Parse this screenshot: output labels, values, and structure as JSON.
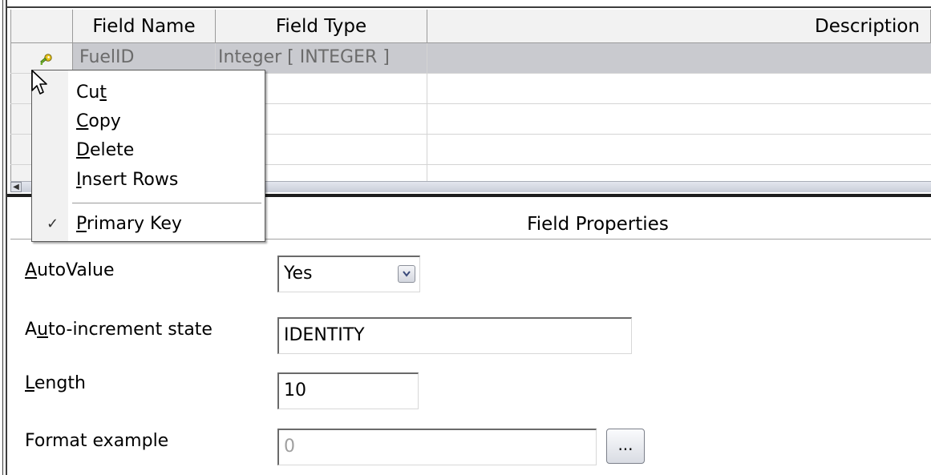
{
  "table": {
    "columns": [
      "Field Name",
      "Field Type",
      "Description"
    ],
    "rows": [
      {
        "name": "FuelID",
        "type": "Integer [ INTEGER ]",
        "description": "",
        "primary_key": true
      }
    ]
  },
  "context_menu": {
    "items": [
      {
        "label": "Cut",
        "mnemonic": "t"
      },
      {
        "label": "Copy",
        "mnemonic": "C"
      },
      {
        "label": "Delete",
        "mnemonic": "D"
      },
      {
        "label": "Insert Rows",
        "mnemonic": "I"
      }
    ],
    "checked_item": {
      "label": "Primary Key",
      "mnemonic": "P",
      "checked": true
    }
  },
  "properties": {
    "title": "Field Properties",
    "autovalue": {
      "label": "AutoValue",
      "mnemonic": "A",
      "value": "Yes"
    },
    "auto_increment": {
      "label": "Auto-increment state",
      "mnemonic": "u",
      "value": "IDENTITY"
    },
    "length": {
      "label": "Length",
      "mnemonic": "L",
      "value": "10"
    },
    "format_example": {
      "label": "Format example",
      "value": "0",
      "button_label": "..."
    }
  },
  "icons": {
    "primary_key": "key-icon",
    "cursor": "mouse-pointer-icon",
    "dropdown": "chevron-down-icon",
    "scroll_left": "arrow-left-icon"
  }
}
